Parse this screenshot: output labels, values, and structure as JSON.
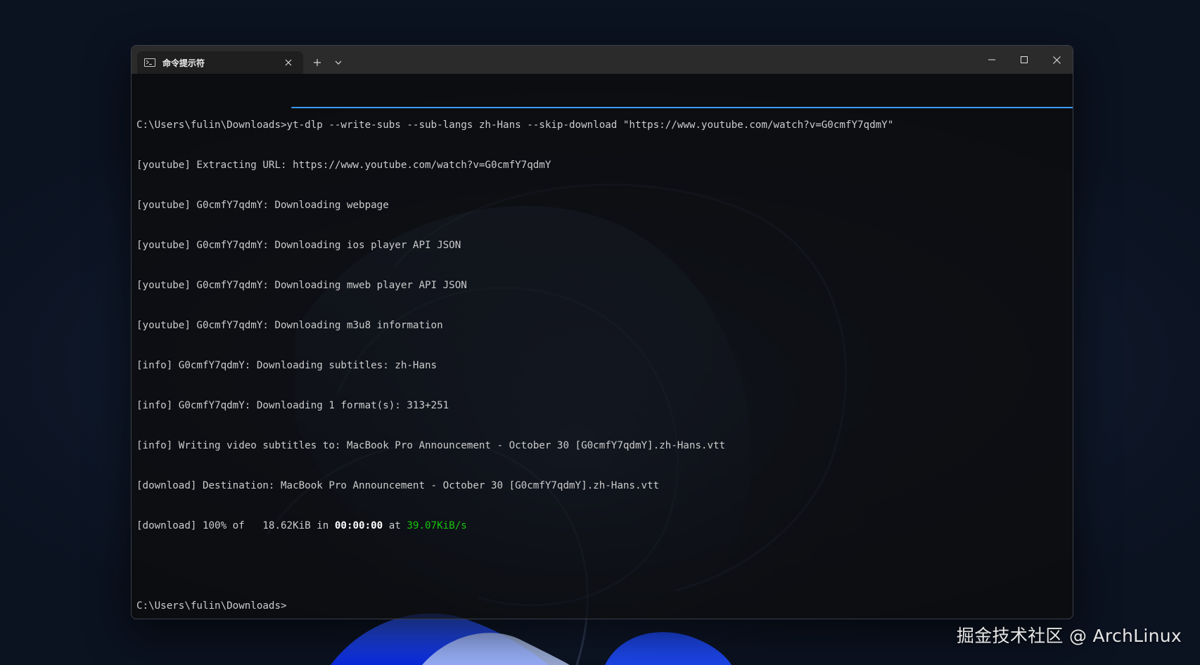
{
  "window": {
    "tab_title": "命令提示符",
    "tab_icon": "cmd-icon",
    "new_tab_icon": "plus-icon",
    "dropdown_icon": "chevron-down-icon",
    "minimize_icon": "minimize-icon",
    "maximize_icon": "maximize-icon",
    "close_icon": "close-icon"
  },
  "console": {
    "command_line": "C:\\Users\\fulin\\Downloads>yt-dlp --write-subs --sub-langs zh-Hans --skip-download \"https://www.youtube.com/watch?v=G0cmfY7qdmY\"",
    "output_lines": [
      "[youtube] Extracting URL: https://www.youtube.com/watch?v=G0cmfY7qdmY",
      "[youtube] G0cmfY7qdmY: Downloading webpage",
      "[youtube] G0cmfY7qdmY: Downloading ios player API JSON",
      "[youtube] G0cmfY7qdmY: Downloading mweb player API JSON",
      "[youtube] G0cmfY7qdmY: Downloading m3u8 information",
      "[info] G0cmfY7qdmY: Downloading subtitles: zh-Hans",
      "[info] G0cmfY7qdmY: Downloading 1 format(s): 313+251",
      "[info] Writing video subtitles to: MacBook Pro Announcement - October 30 [G0cmfY7qdmY].zh-Hans.vtt",
      "[download] Destination: MacBook Pro Announcement - October 30 [G0cmfY7qdmY].zh-Hans.vtt"
    ],
    "progress": {
      "prefix": "[download] 100% of   18.62KiB in ",
      "time": "00:00:00",
      "middle": " at ",
      "speed": "39.07KiB/s"
    },
    "prompt": "C:\\Users\\fulin\\Downloads>"
  },
  "colors": {
    "speed_green": "#16c60c",
    "underline_blue": "#3b9bff"
  },
  "watermark": "掘金技术社区 @ ArchLinux"
}
